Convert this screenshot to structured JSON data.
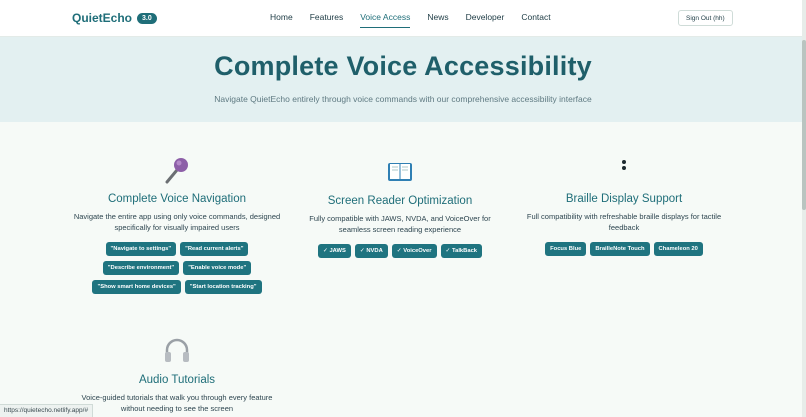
{
  "brand": {
    "name": "QuietEcho",
    "version": "3.0"
  },
  "nav": {
    "items": [
      {
        "label": "Home",
        "active": false
      },
      {
        "label": "Features",
        "active": false
      },
      {
        "label": "Voice Access",
        "active": true
      },
      {
        "label": "News",
        "active": false
      },
      {
        "label": "Developer",
        "active": false
      },
      {
        "label": "Contact",
        "active": false
      }
    ],
    "sign_out": "Sign Out (hh)"
  },
  "hero": {
    "title": "Complete Voice Accessibility",
    "subtitle": "Navigate QuietEcho entirely through voice commands with our comprehensive accessibility interface"
  },
  "features": [
    {
      "icon": "microphone-icon",
      "title": "Complete Voice Navigation",
      "description": "Navigate the entire app using only voice commands, designed specifically for visually impaired users",
      "chips": [
        "\"Navigate to settings\"",
        "\"Read current alerts\"",
        "\"Describe environment\"",
        "\"Enable voice mode\"",
        "\"Show smart home devices\"",
        "\"Start location tracking\""
      ]
    },
    {
      "icon": "book-icon",
      "title": "Screen Reader Optimization",
      "description": "Fully compatible with JAWS, NVDA, and VoiceOver for seamless screen reading experience",
      "chips": [
        "✓ JAWS",
        "✓ NVDA",
        "✓ VoiceOver",
        "✓ TalkBack"
      ]
    },
    {
      "icon": "braille-icon",
      "title": "Braille Display Support",
      "description": "Full compatibility with refreshable braille displays for tactile feedback",
      "chips": [
        "Focus Blue",
        "BrailleNote Touch",
        "Chameleon 20"
      ]
    },
    {
      "icon": "headphones-icon",
      "title": "Audio Tutorials",
      "description": "Voice-guided tutorials that walk you through every feature without needing to see the screen",
      "chips": []
    }
  ],
  "status_bar": {
    "url": "https://quietecho.netlify.app/#"
  }
}
